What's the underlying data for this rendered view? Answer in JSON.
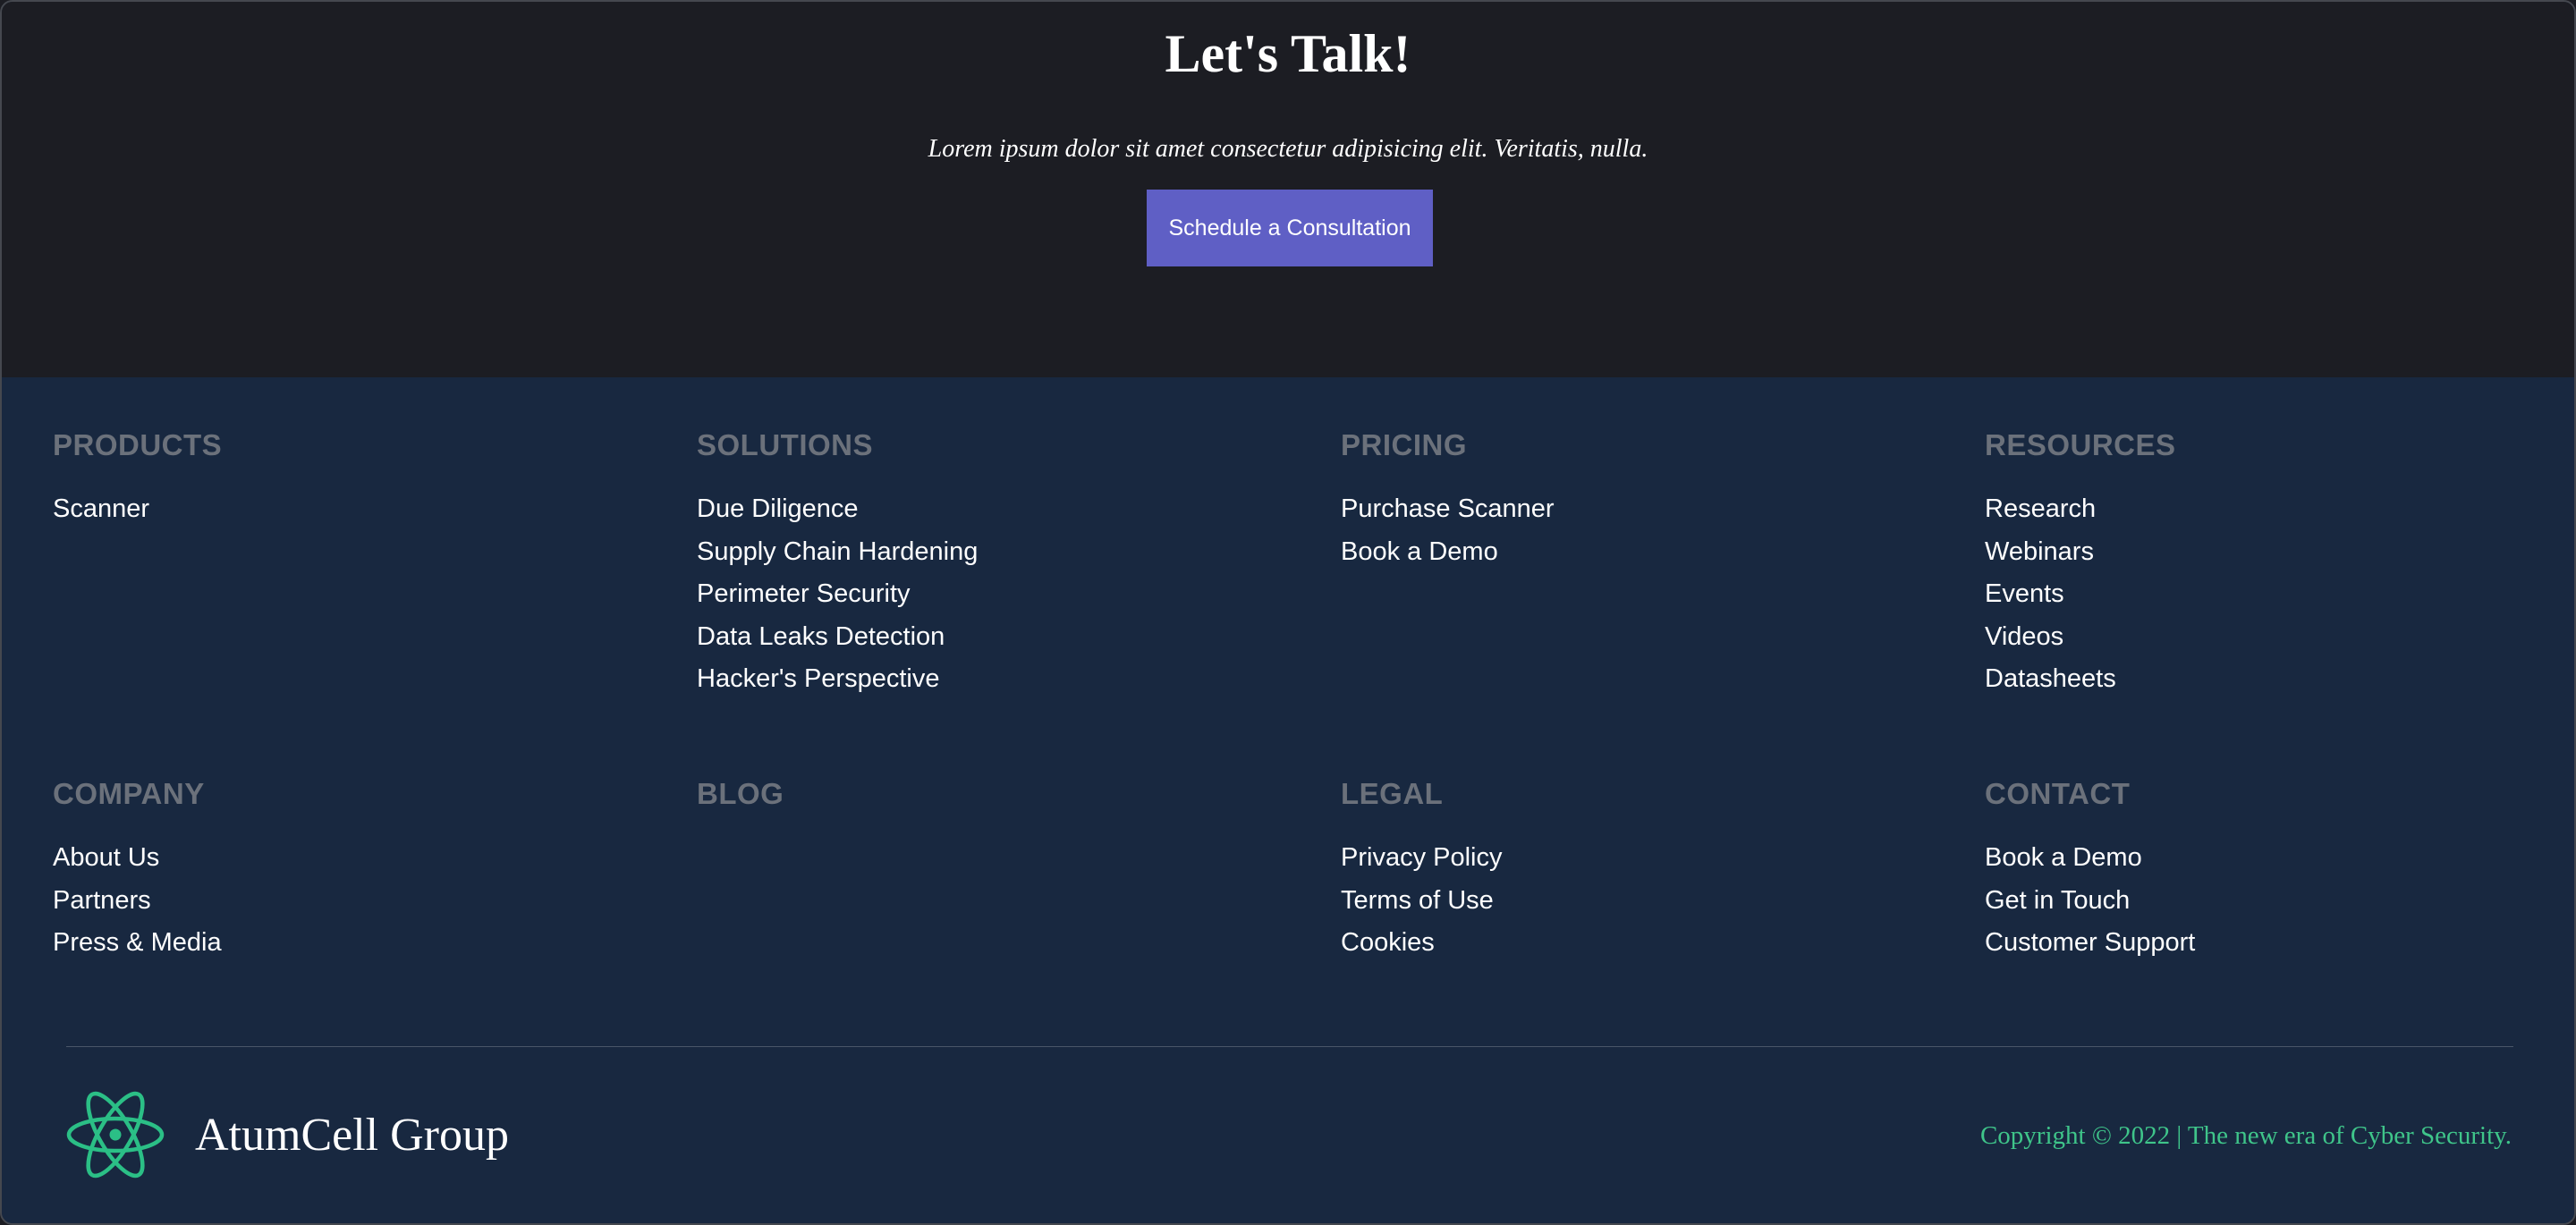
{
  "cta": {
    "title": "Let's Talk!",
    "subtitle": "Lorem ipsum dolor sit amet consectetur adipisicing elit. Veritatis, nulla.",
    "button_label": "Schedule a Consultation"
  },
  "footer": {
    "columns": [
      {
        "heading": "PRODUCTS",
        "links": [
          "Scanner"
        ]
      },
      {
        "heading": "SOLUTIONS",
        "links": [
          "Due Diligence",
          "Supply Chain Hardening",
          "Perimeter Security",
          "Data Leaks Detection",
          "Hacker's Perspective"
        ]
      },
      {
        "heading": "PRICING",
        "links": [
          "Purchase Scanner",
          "Book a Demo"
        ]
      },
      {
        "heading": "RESOURCES",
        "links": [
          "Research",
          "Webinars",
          "Events",
          "Videos",
          "Datasheets"
        ]
      },
      {
        "heading": "COMPANY",
        "links": [
          "About Us",
          "Partners",
          "Press & Media"
        ]
      },
      {
        "heading": "BLOG",
        "links": []
      },
      {
        "heading": "LEGAL",
        "links": [
          "Privacy Policy",
          "Terms of Use",
          "Cookies"
        ]
      },
      {
        "heading": "CONTACT",
        "links": [
          "Book a Demo",
          "Get in Touch",
          "Customer Support"
        ]
      }
    ]
  },
  "brand": {
    "name": "AtumCell Group",
    "logo_icon": "atom-icon"
  },
  "copyright": "Copyright © 2022 | The new era of Cyber Security.",
  "colors": {
    "cta_background": "#1c1d23",
    "footer_background": "#182840",
    "button": "#5f5fc5",
    "accent_green": "#3fc58a",
    "heading_gray": "#6b717b"
  }
}
